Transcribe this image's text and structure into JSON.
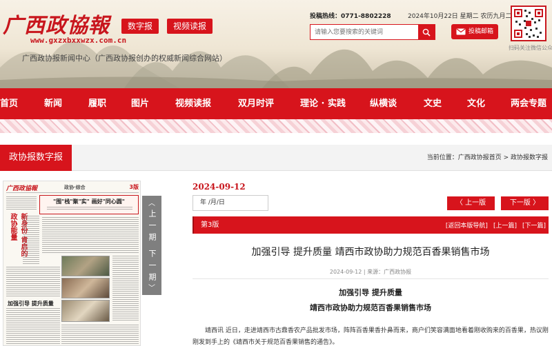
{
  "header": {
    "logo": "广西政協報",
    "site_url": "www.gxzxbxxwzx.com.cn",
    "subtitle": "广西政协报新闻中心（广西政协报创办的权威新闻综合网站）",
    "btn_digital": "数字报",
    "btn_video": "视频读报",
    "hotline_label": "投稿热线：",
    "hotline_number": "0771-8802228",
    "date": "2024年10月22日 星期二 农历九月二十",
    "search_placeholder": "请输入您要搜索的关键词",
    "mail_label": "投稿邮箱",
    "qr_caption": "扫码关注微信公众号"
  },
  "nav": [
    "首页",
    "新闻",
    "履职",
    "图片",
    "视频读报",
    "双月时评",
    "理论 · 实践",
    "纵横谈",
    "文史",
    "文化",
    "两会专题"
  ],
  "section": {
    "title": "政协报数字报",
    "breadcrumb_label": "当前位置：",
    "breadcrumb_path": "广西政协报首页 > 政协报数字报"
  },
  "paper": {
    "logo": "广西政協報",
    "column": "政协·综合",
    "page_no": "3版",
    "headline": "\"围\"栈\"聚\"实\" 画好\"同心圆\"",
    "red_head1": "新身份 肯启的 政协能量",
    "red_head2": "加强引导 提升质量"
  },
  "pager": {
    "prev_label": "上一期",
    "next_label": "下一期"
  },
  "issue": {
    "date": "2024-09-12",
    "date_input": "年 /月/日",
    "prev_page": "〈 上一版",
    "next_page": "下一版 〉"
  },
  "edition": {
    "name": "第3版",
    "back": "[返回本版导航]",
    "prev": "[上一篇]",
    "next": "[下一篇]"
  },
  "article": {
    "title": "加强引导 提升质量 靖西市政协助力规范百香果销售市场",
    "meta": "2024-09-12 | 来源：广西政协报",
    "sub1": "加强引导 提升质量",
    "sub2": "靖西市政协助力规范百香果销售市场",
    "body": "靖西讯 近日，走进靖西市古鼎香农产品批发市场，阵阵百香果香扑鼻而来，商户们笑容满面地看着刚收购来的百香果，热议刚刚发到手上的《靖西市关于规范百香果销售的通告》。"
  },
  "colors": {
    "brand_red": "#d7141c",
    "pager_gray": "#7f7f7f"
  }
}
